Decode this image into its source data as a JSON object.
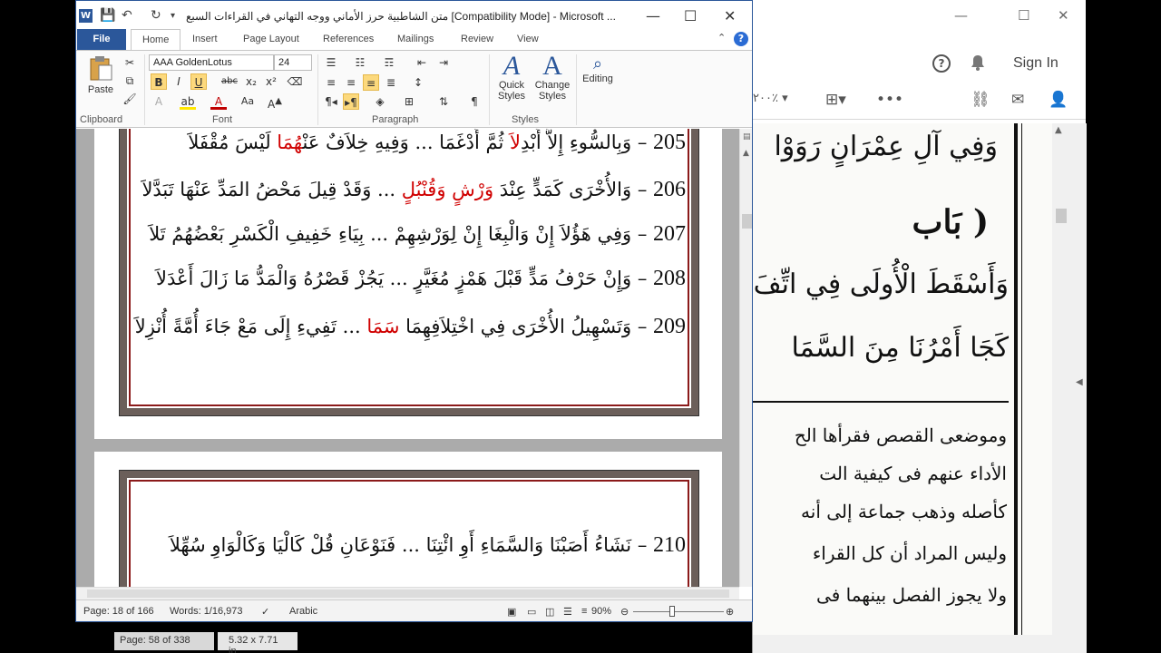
{
  "word": {
    "title": "متن الشاطبية حرز الأماني ووجه التهاني في القراءات السبع [Compatibility Mode]  -  Microsoft ...",
    "app_icon_letter": "W",
    "file_tab": "File",
    "tabs": [
      "Home",
      "Insert",
      "Page Layout",
      "References",
      "Mailings",
      "Review",
      "View"
    ],
    "ribbon": {
      "paste": "Paste",
      "clipboard": "Clipboard",
      "font_name": "AAA GoldenLotus",
      "font_size": "24",
      "font_group": "Font",
      "paragraph_group": "Paragraph",
      "quick_styles": "Quick Styles",
      "change_styles": "Change Styles",
      "styles_group": "Styles",
      "editing": "Editing",
      "bold": "B",
      "italic": "I",
      "underline": "U",
      "strike": "abc",
      "pilcrow": "¶"
    },
    "verses_page1": [
      {
        "num": "205",
        "pre": "وَبِالسُّوءِ إِلاَّ أَبْدِ",
        "red1": "لاَ",
        "mid": " ثُمَّ أَدْغَمَا ... وَفِيهِ خِلاَفٌ عَنْ",
        "red2": "هُمَا",
        "post": " لَيْسَ مُقْفَلاَ"
      },
      {
        "num": "206",
        "pre": "وَالأُخْرَى كَمَدٍّ عِنْدَ ",
        "red1": "وَرْشٍ وَقُنْبُلٍ",
        "mid": " ... وَقَدْ قِيلَ مَحْضُ المَدِّ عَنْهَا تَبَدَّلاَ",
        "red2": "",
        "post": ""
      },
      {
        "num": "207",
        "pre": "وَفِي هَؤُلاَ إِنْ وَالْبِغَا إِنْ لِوَرْشِهِمْ ... بِيَاءِ خَفِيفِ الْكَسْرِ بَعْضُهُمُ تَلاَ",
        "red1": "",
        "mid": "",
        "red2": "",
        "post": ""
      },
      {
        "num": "208",
        "pre": "وَإِنْ حَرْفُ مَدٍّ قَبْلَ هَمْزٍ مُغَيَّرٍ ... يَجُزْ قَصْرُهُ وَالْمَدُّ مَا زَالَ أَعْدَلاَ",
        "red1": "",
        "mid": "",
        "red2": "",
        "post": ""
      },
      {
        "num": "209",
        "pre": "وَتَسْهِيلُ الأُخْرَى فِي اخْتِلاَفِهِمَا ",
        "red1": "سَمَا",
        "mid": " ... تَفِيءِ إِلَى مَعْ جَاءَ أُمَّةً أُنْزِلاَ",
        "red2": "",
        "post": ""
      }
    ],
    "verses_page2": [
      {
        "num": "210",
        "text": "نَشَاءُ أَصَبْنَا وَالسَّمَاءِ أَوِ ائْتِنَا ... فَنَوْعَانِ قُلْ كَالْيَا وَكَالْوَاوِ سُهِّلاَ"
      }
    ],
    "status": {
      "page": "Page: 18 of 166",
      "words": "Words: 1/16,973",
      "language": "Arabic",
      "zoom": "90%"
    }
  },
  "pdf": {
    "sign_in": "Sign In",
    "zoom_label": "٢٠٠٪",
    "page_verses": [
      "وَفِي آلِ عِمْرَانٍ رَوَوْا",
      "( بَاب",
      "وَأَسْقَطَ الْأُولَى فِي اتِّفَ",
      "كَجَا أَمْرُنَا مِنَ السَّمَا"
    ],
    "page_prose": [
      "وموضعى القصص فقرأها الح",
      "الأداء عنهم فى كيفية الت",
      "كأصله وذهب جماعة إلى أنه",
      "وليس المراد أن كل القراء",
      "ولا يجوز الفصل بينهما فى"
    ]
  },
  "background_status": {
    "page": "Page: 58 of 338",
    "size": "5.32 x 7.71 in"
  }
}
